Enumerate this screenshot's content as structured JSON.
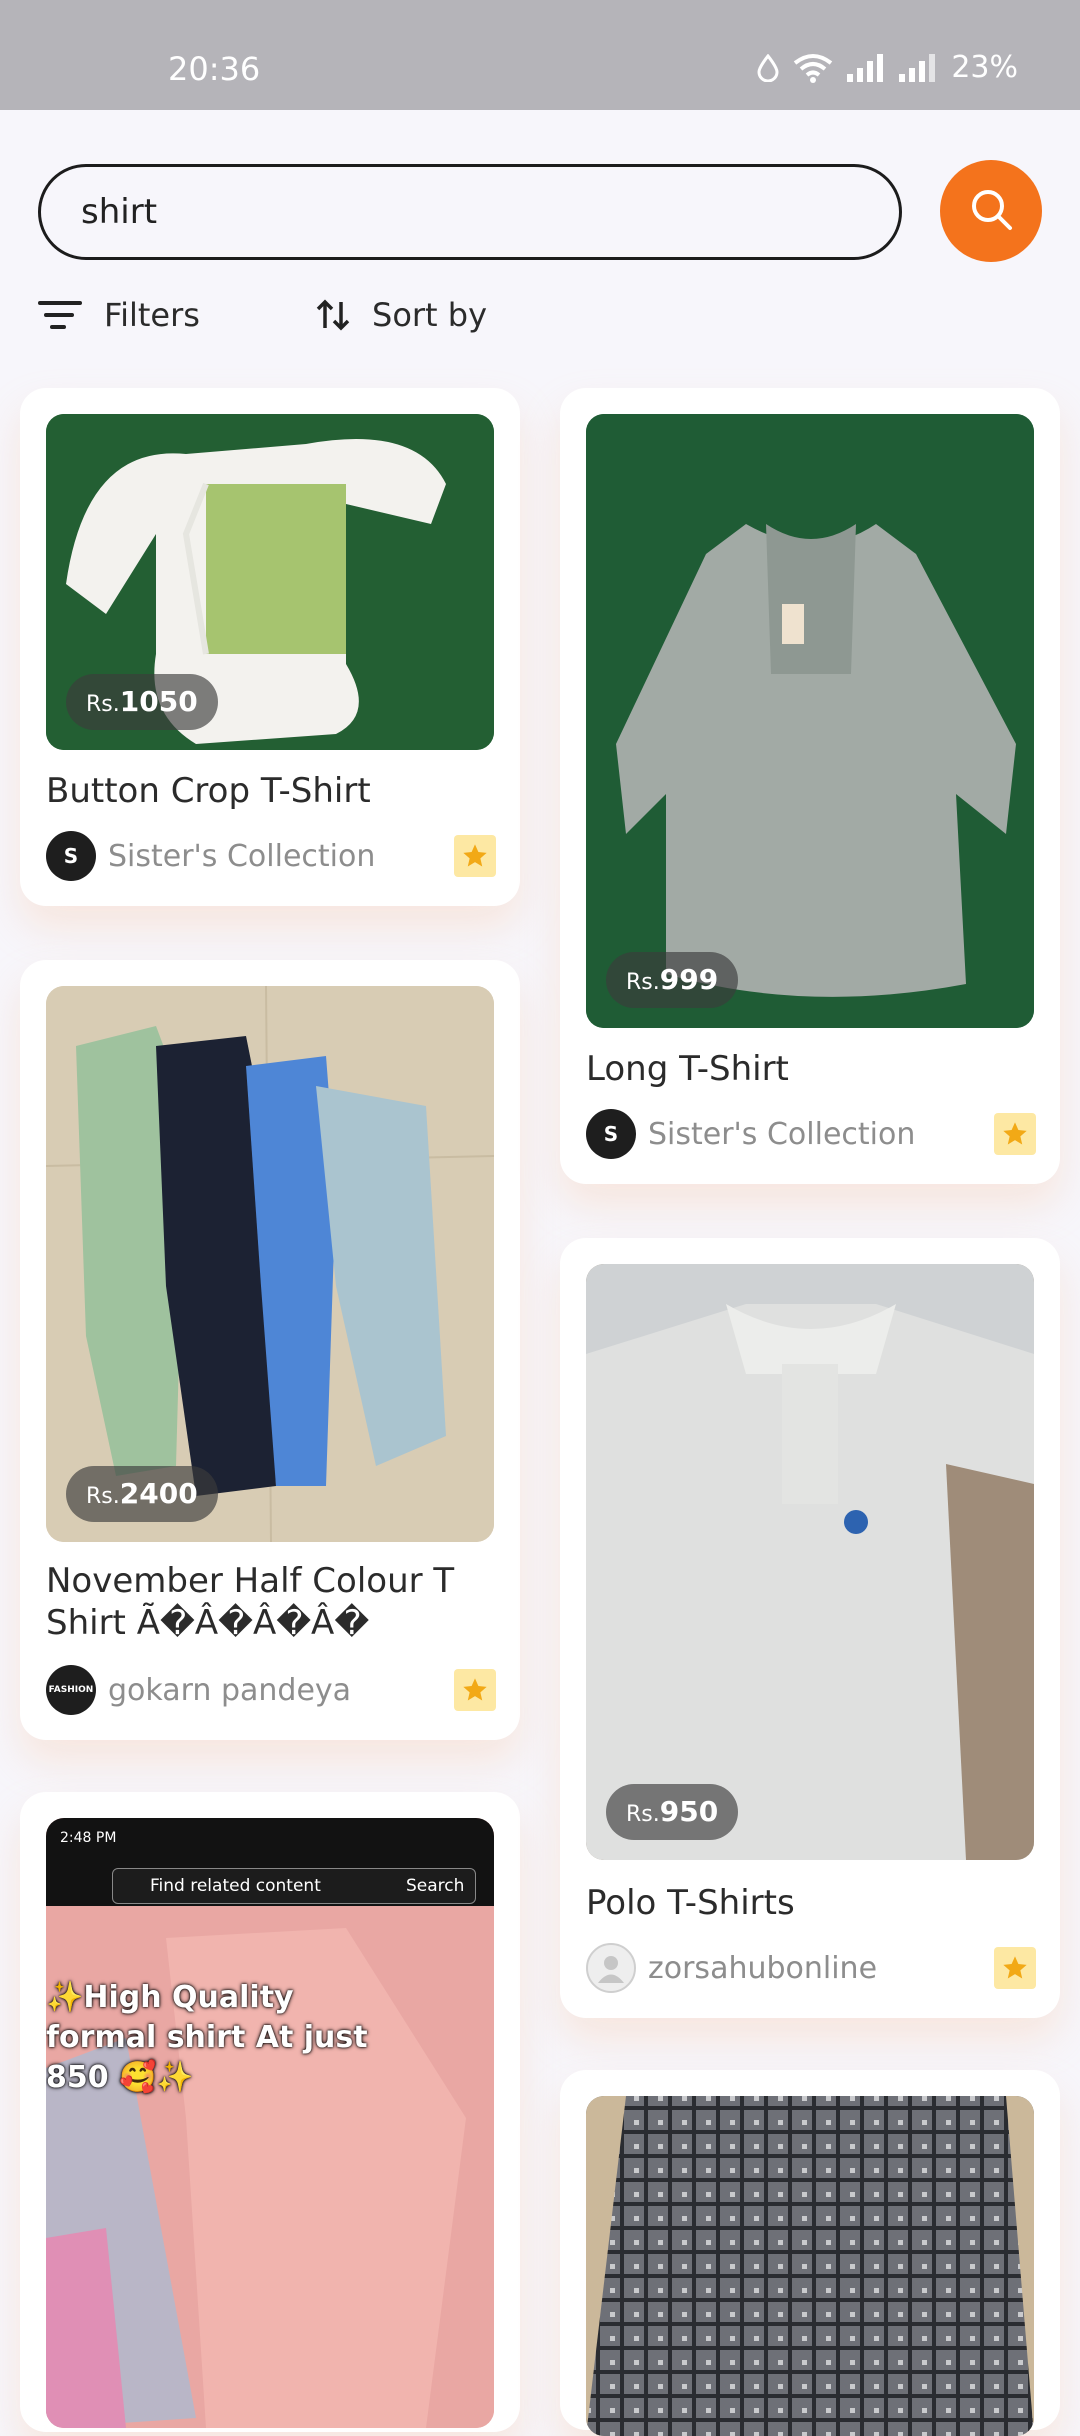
{
  "status_bar": {
    "time": "20:36",
    "battery": "23%",
    "icons": [
      "water-drop-icon",
      "wifi-icon",
      "signal-icon",
      "signal-icon",
      "battery-text"
    ]
  },
  "search": {
    "value": "shirt",
    "button_icon": "search-icon"
  },
  "toolbar": {
    "filters_label": "Filters",
    "sort_label": "Sort by"
  },
  "colors": {
    "accent": "#f4731c",
    "favorite_bg": "#fde8a3",
    "favorite_star": "#f2a916"
  },
  "products": [
    {
      "currency": "Rs.",
      "price": "1050",
      "title": "Button Crop T-Shirt",
      "seller": "Sister's Collection",
      "avatar_text": "S",
      "favorite": true
    },
    {
      "currency": "Rs.",
      "price": "999",
      "title": "Long T-Shirt",
      "seller": "Sister's Collection",
      "avatar_text": "S",
      "favorite": true
    },
    {
      "currency": "Rs.",
      "price": "2400",
      "title": "November Half Colour T Shirt Ã�Â�Â�Â�",
      "seller": "gokarn pandeya",
      "avatar_text": "FASHION",
      "favorite": true
    },
    {
      "currency": "Rs.",
      "price": "950",
      "title": "Polo T-Shirts",
      "seller": "zorsahubonline",
      "avatar_text": "",
      "favorite": true
    },
    {
      "embedded_screenshot": {
        "time": "2:48 PM",
        "search_placeholder": "Find related content",
        "search_button": "Search",
        "caption": "✨High Quality formal shirt At just 850 🥰✨"
      }
    }
  ]
}
